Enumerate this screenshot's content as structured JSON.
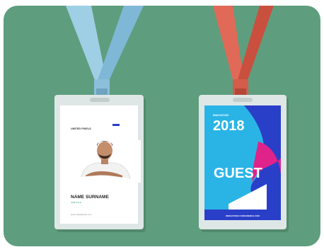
{
  "colors": {
    "background": "#5e9e7e",
    "lanyard_left": "#8fc3dc",
    "lanyard_right": "#d9604e",
    "badge_holder": "#dfe7e6",
    "accent_blue": "#2a3fc8",
    "accent_magenta": "#e0238a",
    "accent_cyan": "#2ab4e6"
  },
  "left_badge": {
    "company": "UNITED PIXELS",
    "name": "NAME SURNAME",
    "role": "JOB TITLE",
    "website": "www.unitedpixels.com"
  },
  "right_badge": {
    "event_small": "INNOVATION",
    "year": "2018",
    "role": "GUEST",
    "footer": "INNOVATION CONFERENCE 2018"
  }
}
